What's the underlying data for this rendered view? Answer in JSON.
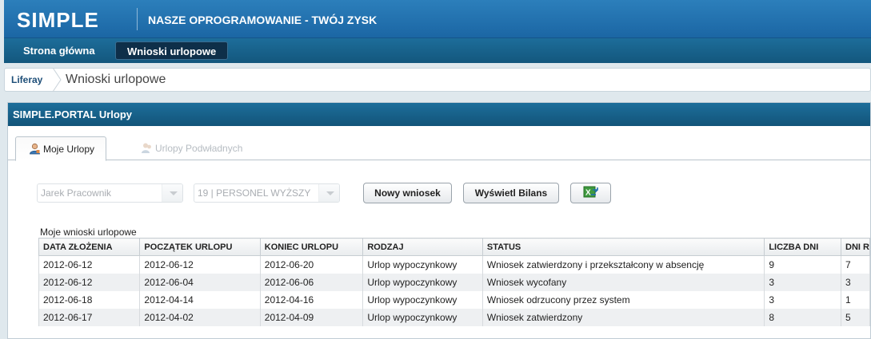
{
  "header": {
    "logo": "SIMPLE",
    "slogan": "NASZE OPROGRAMOWANIE - TWÓJ ZYSK"
  },
  "nav": {
    "items": [
      {
        "label": "Strona główna"
      },
      {
        "label": "Wnioski urlopowe"
      }
    ]
  },
  "breadcrumb": {
    "home": "Liferay",
    "current": "Wnioski urlopowe"
  },
  "portlet": {
    "title": "SIMPLE.PORTAL Urlopy",
    "tabs": [
      {
        "label": "Moje Urlopy"
      },
      {
        "label": "Urlopy Podwładnych"
      }
    ],
    "employee_select": {
      "value": "Jarek Pracownik"
    },
    "group_select": {
      "value": "19 | PERSONEL WYŻSZY"
    },
    "buttons": {
      "new_request": "Nowy wniosek",
      "show_balance": "Wyświetl Bilans"
    },
    "list_caption": "Moje wnioski urlopowe",
    "table": {
      "columns": [
        "DATA ZŁOŻENIA",
        "POCZĄTEK URLOPU",
        "KONIEC URLOPU",
        "RODZAJ",
        "STATUS",
        "LICZBA DNI",
        "DNI R"
      ],
      "rows": [
        [
          "2012-06-12",
          "2012-06-12",
          "2012-06-20",
          "Urlop wypoczynkowy",
          "Wniosek zatwierdzony i przekształcony w absencję",
          "9",
          "7"
        ],
        [
          "2012-06-12",
          "2012-06-04",
          "2012-06-06",
          "Urlop wypoczynkowy",
          "Wniosek wycofany",
          "3",
          "3"
        ],
        [
          "2012-06-18",
          "2012-04-14",
          "2012-04-16",
          "Urlop wypoczynkowy",
          "Wniosek odrzucony przez system",
          "3",
          "1"
        ],
        [
          "2012-06-17",
          "2012-04-02",
          "2012-04-09",
          "Urlop wypoczynkowy",
          "Wniosek zatwierdzony",
          "8",
          "5"
        ]
      ]
    }
  },
  "icons": {
    "tab_my": "user-icon",
    "tab_subordinates": "users-icon",
    "export": "excel-export-icon"
  }
}
